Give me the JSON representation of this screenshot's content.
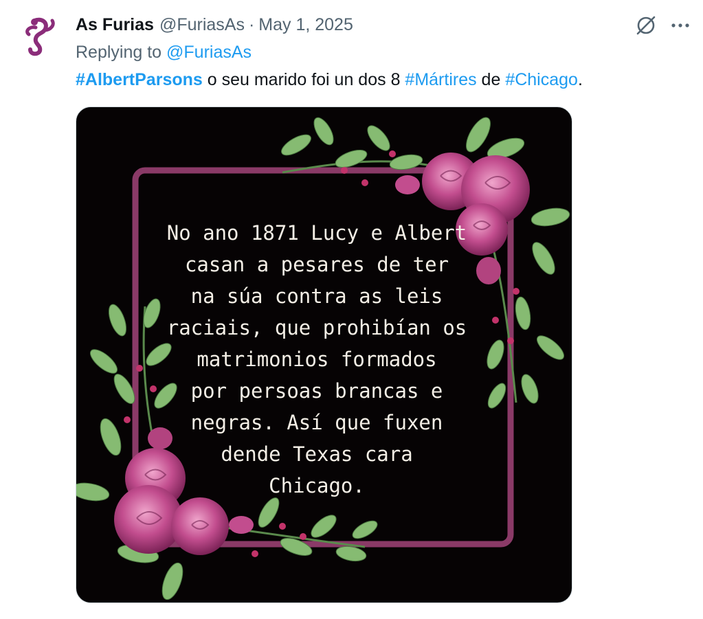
{
  "tweet": {
    "author": {
      "display_name": "As Furias",
      "handle": "@FuriasAs",
      "avatar_icon": "purple-figure-logo-icon"
    },
    "separator": "·",
    "date": "May 1, 2025",
    "reply": {
      "prefix": "Replying to",
      "mention": "@FuriasAs"
    },
    "text": {
      "hashtag1": "#AlbertParsons",
      "part1": " o seu marido foi un dos 8 ",
      "hashtag2": "#Mártires",
      "part2": " de ",
      "hashtag3": "#Chicago",
      "part3": "."
    },
    "media": {
      "text": "No ano 1871 Lucy e Albert\ncasan a pesares de ter\nna súa contra as leis\nraciais, que prohibían os\nmatrimonios formados\npor persoas brancas e\nnegras. Así que fuxen\ndende Texas cara\nChicago."
    },
    "actions": {
      "grok_icon": "grok-icon",
      "more_icon": "more-icon"
    }
  },
  "colors": {
    "link": "#1d9bf0",
    "secondary_text": "#536471",
    "frame": "#8a3a67",
    "rose": "#c24d8e",
    "leaf": "#7fb56f"
  }
}
